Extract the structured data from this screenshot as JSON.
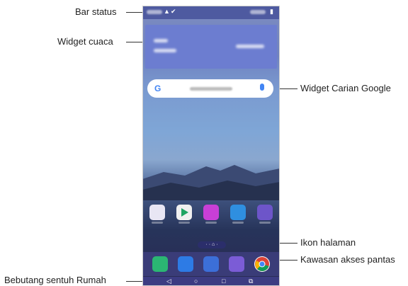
{
  "callouts": {
    "status_bar": "Bar status",
    "weather_widget": "Widget cuaca",
    "google_search_widget": "Widget Carian Google",
    "page_icon": "Ikon halaman",
    "quick_access_area": "Kawasan akses pantas",
    "home_touch_buttons": "Bebutang sentuh Rumah"
  },
  "search": {
    "logo": "G"
  },
  "icons": {
    "status": [
      "warning-icon",
      "check-icon",
      "wifi-icon",
      "battery-icon"
    ],
    "home_apps": [
      "folder-icon",
      "play-store-icon",
      "pen-icon",
      "chat-icon",
      "settings-icon"
    ],
    "dock": [
      "phone-icon",
      "messages-icon",
      "camera-icon",
      "gallery-icon",
      "chrome-icon"
    ],
    "nav": [
      "back-icon",
      "home-icon",
      "recents-icon",
      "dual-window-icon"
    ]
  },
  "colors": {
    "google_blue": "#4285f4",
    "phone_green": "#2bb673",
    "messages_blue": "#2d7be5",
    "camera_blue": "#3c6fd8",
    "gallery_purple": "#7b5cd6",
    "settings_purple": "#6d55c9"
  }
}
